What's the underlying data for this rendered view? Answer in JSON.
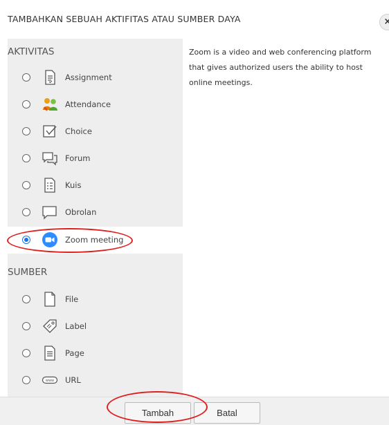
{
  "dialog": {
    "title": "TAMBAHKAN SEBUAH AKTIFITAS ATAU SUMBER DAYA",
    "close_glyph": "×"
  },
  "sections": {
    "activities": "AKTIVITAS",
    "resources": "SUMBER"
  },
  "activities": [
    {
      "label": "Assignment",
      "icon": "assignment-icon"
    },
    {
      "label": "Attendance",
      "icon": "attendance-icon"
    },
    {
      "label": "Choice",
      "icon": "choice-icon"
    },
    {
      "label": "Forum",
      "icon": "forum-icon"
    },
    {
      "label": "Kuis",
      "icon": "quiz-icon"
    },
    {
      "label": "Obrolan",
      "icon": "chat-icon"
    },
    {
      "label": "Zoom meeting",
      "icon": "zoom-icon",
      "selected": true
    }
  ],
  "resources": [
    {
      "label": "File",
      "icon": "file-icon"
    },
    {
      "label": "Label",
      "icon": "label-icon"
    },
    {
      "label": "Page",
      "icon": "page-icon"
    },
    {
      "label": "URL",
      "icon": "url-icon"
    }
  ],
  "description": "Zoom is a video and web conferencing platform that gives authorized users the ability to host online meetings.",
  "buttons": {
    "add": "Tambah",
    "cancel": "Batal"
  },
  "colors": {
    "selected_radio": "#1a73e8",
    "zoom_blue": "#2d8cff",
    "annotation_ring": "#e01e1e"
  }
}
